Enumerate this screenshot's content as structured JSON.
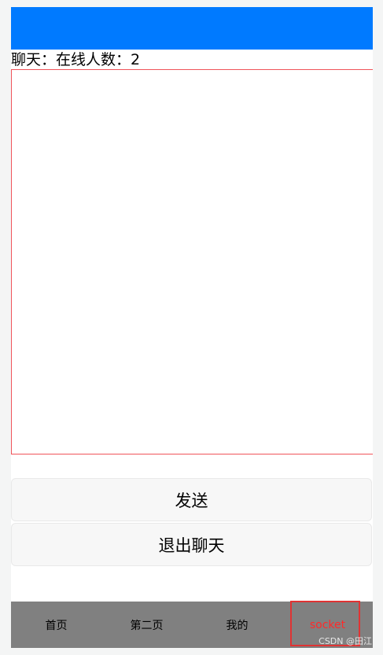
{
  "header": {
    "bar_color": "#007aff"
  },
  "chat": {
    "title": "聊天：在线人数：2",
    "box_border_color": "#f0545a"
  },
  "actions": {
    "send_label": "发送",
    "exit_label": "退出聊天"
  },
  "tabbar": {
    "background": "#808080",
    "active_color": "#ff2a2a",
    "items": [
      {
        "label": "首页"
      },
      {
        "label": "第二页"
      },
      {
        "label": "我的"
      },
      {
        "label": "socket"
      }
    ],
    "active_index": 3
  },
  "watermark": "CSDN @田江"
}
